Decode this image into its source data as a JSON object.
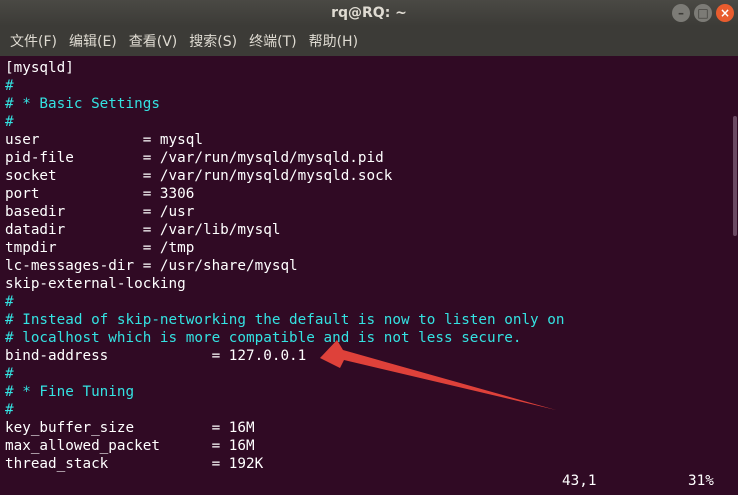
{
  "window": {
    "title": "rq@RQ: ~",
    "buttons": [
      "–",
      "□",
      "×"
    ]
  },
  "menu": [
    "文件(F)",
    "编辑(E)",
    "查看(V)",
    "搜索(S)",
    "终端(T)",
    "帮助(H)"
  ],
  "terminal": {
    "lines": [
      {
        "text": "[mysqld]",
        "kind": "normal"
      },
      {
        "text": "#",
        "kind": "comment"
      },
      {
        "text": "# * Basic Settings",
        "kind": "comment"
      },
      {
        "text": "#",
        "kind": "comment"
      },
      {
        "text": "user            = mysql",
        "kind": "normal"
      },
      {
        "text": "pid-file        = /var/run/mysqld/mysqld.pid",
        "kind": "normal"
      },
      {
        "text": "socket          = /var/run/mysqld/mysqld.sock",
        "kind": "normal"
      },
      {
        "text": "port            = 3306",
        "kind": "normal"
      },
      {
        "text": "basedir         = /usr",
        "kind": "normal"
      },
      {
        "text": "datadir         = /var/lib/mysql",
        "kind": "normal"
      },
      {
        "text": "tmpdir          = /tmp",
        "kind": "normal"
      },
      {
        "text": "lc-messages-dir = /usr/share/mysql",
        "kind": "normal"
      },
      {
        "text": "skip-external-locking",
        "kind": "normal"
      },
      {
        "text": "#",
        "kind": "comment"
      },
      {
        "text": "# Instead of skip-networking the default is now to listen only on",
        "kind": "comment"
      },
      {
        "text": "# localhost which is more compatible and is not less secure.",
        "kind": "comment"
      },
      {
        "text": "bind-address            = 127.0.0.1",
        "kind": "normal"
      },
      {
        "text": "#",
        "kind": "comment"
      },
      {
        "text": "# * Fine Tuning",
        "kind": "comment"
      },
      {
        "text": "#",
        "kind": "comment"
      },
      {
        "text": "key_buffer_size         = 16M",
        "kind": "normal"
      },
      {
        "text": "max_allowed_packet      = 16M",
        "kind": "normal"
      },
      {
        "text": "thread_stack            = 192K",
        "kind": "normal"
      }
    ],
    "status_position": "43,1",
    "status_percent": "31%"
  },
  "colors": {
    "terminal_bg": "#300a24",
    "comment": "#34e2e2",
    "text": "#ffffff",
    "arrow": "#e8453c"
  }
}
